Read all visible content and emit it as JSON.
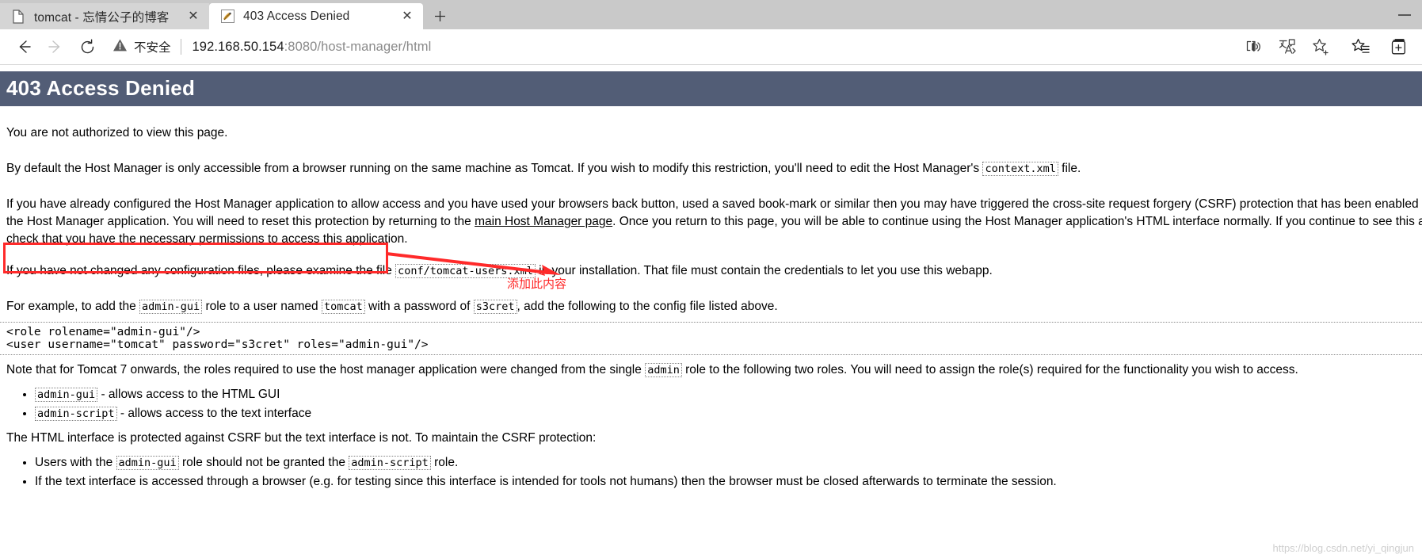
{
  "window": {
    "minimize_label": "—"
  },
  "tabs": [
    {
      "title": "tomcat - 忘情公子的博客",
      "favicon": "document-icon",
      "close_label": "✕",
      "active": false
    },
    {
      "title": "403 Access Denied",
      "favicon": "tomcat-icon",
      "close_label": "✕",
      "active": true
    }
  ],
  "newtab": {
    "label": "+",
    "icon": "plus-icon"
  },
  "navigation": {
    "back": "back-arrow-icon",
    "forward": "forward-arrow-icon",
    "refresh": "refresh-icon"
  },
  "address_bar": {
    "security_icon": "warning-triangle-icon",
    "security_label": "不安全",
    "url_host": "192.168.50.154",
    "url_rest": ":8080/host-manager/html",
    "url_full": "192.168.50.154:8080/host-manager/html"
  },
  "toolbar_icons": [
    {
      "name": "read-aloud-icon",
      "title": "朗读此页内容"
    },
    {
      "name": "translate-icon",
      "title": "翻译"
    },
    {
      "name": "add-favorite-icon",
      "title": "将此页添加到收藏夹"
    },
    {
      "name": "favorites-list-icon",
      "title": "收藏夹"
    },
    {
      "name": "collections-icon",
      "title": "集锦"
    }
  ],
  "page": {
    "banner_title": "403 Access Denied",
    "paragraphs": {
      "p1": "You are not authorized to view this page.",
      "p2_a": "By default the Host Manager is only accessible from a browser running on the same machine as Tomcat. If you wish to modify this restriction, you'll need to edit the Host Manager's ",
      "p2_code": "context.xml",
      "p2_b": " file.",
      "p3_a": "If you have already configured the Host Manager application to allow access and you have used your browsers back button, used a saved book-mark or similar then you may have triggered the cross-site request forgery (CSRF) protection that has been enabled for the HTML interface of the Host Manager application. You will need to reset this protection by returning to the ",
      "p3_link": "main Host Manager page",
      "p3_b": ". Once you return to this page, you will be able to continue using the Host Manager application's HTML interface normally. If you continue to see this access denied message, check that you have the necessary permissions to access this application.",
      "p4_a": "If you have not changed any configuration files, please examine the file ",
      "p4_code": "conf/tomcat-users.xml",
      "p4_b": " in your installation. That file must contain the credentials to let you use this webapp.",
      "p5_a": "For example, to add the ",
      "p5_code1": "admin-gui",
      "p5_b": " role to a user named ",
      "p5_code2": "tomcat",
      "p5_c": " with a password of ",
      "p5_code3": "s3cret",
      "p5_d": ", add the following to the config file listed above.",
      "p6_a": "Note that for Tomcat 7 onwards, the roles required to use the host manager application were changed from the single ",
      "p6_code": "admin",
      "p6_b": " role to the following two roles. You will need to assign the role(s) required for the functionality you wish to access.",
      "p7": "The HTML interface is protected against CSRF but the text interface is not. To maintain the CSRF protection:"
    },
    "code_block": {
      "line1": "<role rolename=\"admin-gui\"/>",
      "line2": "<user username=\"tomcat\" password=\"s3cret\" roles=\"admin-gui\"/>"
    },
    "roles_list": [
      {
        "code": "admin-gui",
        "text": " - allows access to the HTML GUI"
      },
      {
        "code": "admin-script",
        "text": " - allows access to the text interface"
      }
    ],
    "csrf_list": [
      {
        "a": "Users with the ",
        "code1": "admin-gui",
        "b": " role should not be granted the ",
        "code2": "admin-script",
        "c": " role."
      },
      {
        "a": "If the text interface is accessed through a browser (e.g. for testing since this interface is intended for tools not humans) then the browser must be closed afterwards to terminate the session.",
        "code1": "",
        "b": "",
        "code2": "",
        "c": ""
      }
    ]
  },
  "annotation": {
    "label": "添加此内容",
    "color": "#ff2323",
    "rect_color": "#ff2a2a"
  },
  "watermark": "https://blog.csdn.net/yi_qingjun",
  "colors": {
    "banner_bg": "#525d76",
    "tabstrip_bg": "#c9c9c9",
    "annotation_red": "#ff2323"
  }
}
